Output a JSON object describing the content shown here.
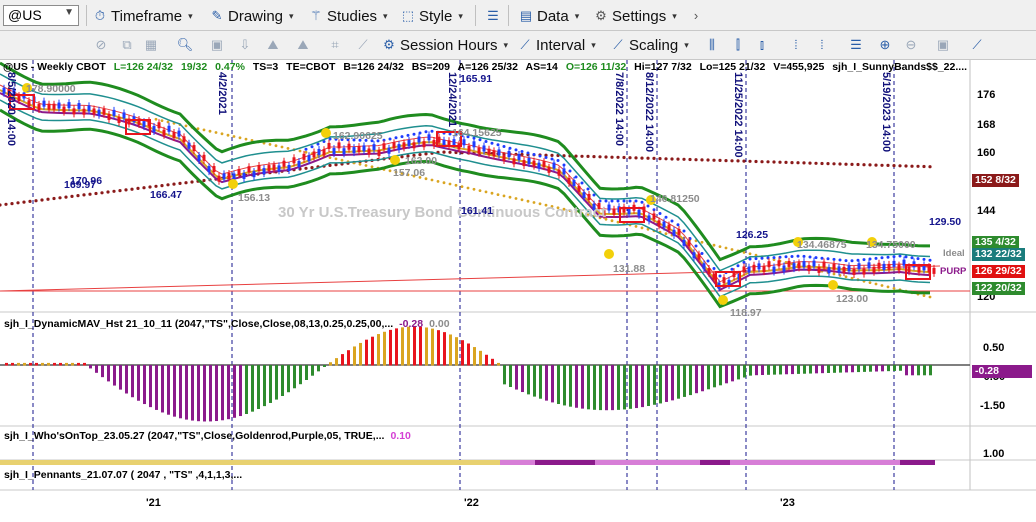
{
  "toolbar1": {
    "symbol": "@US",
    "timeframe": "Timeframe",
    "drawing": "Drawing",
    "studies": "Studies",
    "style": "Style",
    "data": "Data",
    "settings": "Settings"
  },
  "toolbar2": {
    "session_hours": "Session Hours",
    "interval": "Interval",
    "scaling": "Scaling"
  },
  "header": {
    "symbol": "@US - Weekly  CBOT",
    "L": "L=126 24/32",
    "change": "19/32",
    "pct": "0.47%",
    "TS": "TS=3",
    "TE": "TE=CBOT",
    "B": "B=126 24/32",
    "BS": "BS=209",
    "A": "A=126 25/32",
    "AS": "AS=14",
    "O": "O=126 11/32",
    "Hi": "Hi=127 7/32",
    "Lo": "Lo=125 21/32",
    "V": "V=455,925",
    "study": "sjh_I_SunnyBands$$_22...."
  },
  "watermark": "30 Yr U.S.Treasury Bond Continuous Contract",
  "price_axis": [
    "176",
    "168",
    "160",
    "144",
    "120"
  ],
  "price_tags": [
    {
      "text": "152 8/32",
      "color": "#8b1a1a"
    },
    {
      "text": "135 4/32",
      "color": "#2e8b2e"
    },
    {
      "text": "132 22/32",
      "color": "#1a7c7c"
    },
    {
      "text": "126 29/32",
      "color": "#e01010"
    },
    {
      "text": "122 20/32",
      "color": "#2e8b2e"
    }
  ],
  "axis_side_labels": {
    "ideal": "Ideal",
    "purple": "PURP",
    "value_12950": "129.50"
  },
  "data_labels": {
    "l165_91": "165.91",
    "l161_41": "161.41",
    "l146": "146.81250",
    "l131_88": "131.88",
    "l126_25": "126.25",
    "l134": "134.46875",
    "l134b": "134.75000",
    "l123": "123.00",
    "l118": "118.97",
    "l169": "169.97",
    "l170": "170.96",
    "l166": "166.47",
    "l162": "162.90625",
    "l157": "157.06",
    "l163": "163.00",
    "l164": "164.15625",
    "l178": "178.90000",
    "l156": "156.13"
  },
  "vertical_dates": [
    "8/5/2020 14:00",
    "4/2/2021",
    "12/24/2021",
    "7/8/2022 14:00",
    "8/12/2022 14:00",
    "11/25/2022 14:00",
    "5/19/2023 14:00"
  ],
  "panes": {
    "dynamic_mav": {
      "title": "sjh_I_DynamicMAV_Hst 21_10_11 (2047,\"TS\",Close,Close,08,13,0.25,0.25,00,...",
      "v1": "-0.28",
      "v2": "0.00",
      "axis": [
        "0.50",
        "-0.50",
        "-1.50"
      ],
      "tag": "-0.28"
    },
    "whos_on_top": {
      "title": "sjh_I_Who'sOnTop_23.05.27 (2047,\"TS\",Close,Goldenrod,Purple,05,  TRUE,...",
      "v1": "0.10",
      "axis": [
        "1.00"
      ]
    },
    "pennants": {
      "title": "sjh_I_Pennants_21.07.07 ( 2047 , \"TS\" ,4,1,1,3,..."
    }
  },
  "x_axis": [
    "'21",
    "'22",
    "'23"
  ],
  "colors": {
    "band_green": "#1f8c1f",
    "band_teal": "#1f8f8f",
    "up_bar": "#1e3cff",
    "down_bar": "#e8141e",
    "goldenrod": "#daa520",
    "purple": "#8b1a8b",
    "dark_red": "#8b1a1a"
  }
}
